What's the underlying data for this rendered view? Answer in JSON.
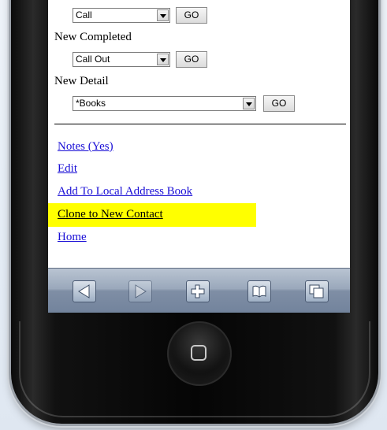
{
  "form": {
    "first_select_value": "Call",
    "go_label": "GO",
    "new_completed_label": "New Completed",
    "completed_select_value": "Call Out",
    "new_detail_label": "New Detail",
    "detail_select_value": "*Books"
  },
  "links": {
    "notes": "Notes (Yes)",
    "edit": "Edit",
    "add_local": "Add To Local Address Book",
    "clone": "Clone to New Contact",
    "home": "Home"
  },
  "toolbar": {
    "buttons": [
      "back-icon",
      "forward-icon",
      "add-icon",
      "bookmarks-icon",
      "pages-icon"
    ]
  },
  "colors": {
    "link": "#1a0fd6",
    "highlight": "#ffff00",
    "toolbar": "#8c9bb0"
  }
}
